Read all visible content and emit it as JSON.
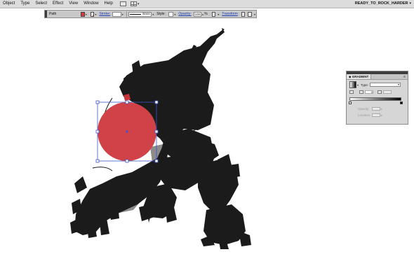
{
  "menubar": {
    "items": [
      "Object",
      "Type",
      "Select",
      "Effect",
      "View",
      "Window",
      "Help"
    ],
    "workspace": "READY_TO_ROCK_HARDER"
  },
  "controlbar": {
    "selection_label": "Path",
    "fill_color": "#d23a3e",
    "stroke_label": "Stroke:",
    "brush_label": "Basic",
    "style_label": "Style:",
    "opacity_label": "Opacity:",
    "opacity_value": "100",
    "opacity_unit": "%",
    "transform_label": "Transform"
  },
  "canvas": {
    "selected_circle_color": "#d04248",
    "selection_color": "#3b56c4",
    "art_color": "#1b1b1b"
  },
  "gradient_panel": {
    "tab_label": "GRADIENT",
    "type_label": "Type:",
    "angle_value": "0",
    "opacity_label": "Opacity:",
    "location_label": "Location:"
  }
}
